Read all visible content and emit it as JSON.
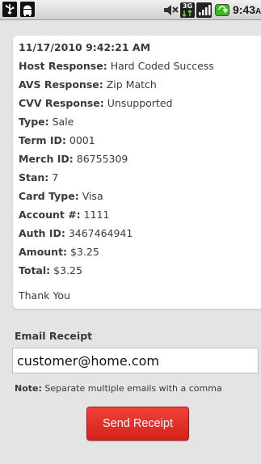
{
  "status_bar": {
    "time": "9:43",
    "ampm": "AM",
    "icons": [
      "usb-icon",
      "android-debug-icon",
      "mute-icon",
      "3g-icon",
      "signal-icon",
      "battery-icon"
    ],
    "network_label": "3G"
  },
  "receipt": {
    "datetime": "11/17/2010 9:42:21 AM",
    "fields": [
      {
        "label": "Host Response:",
        "value": "Hard Coded Success"
      },
      {
        "label": "AVS Response:",
        "value": "Zip Match"
      },
      {
        "label": "CVV Response:",
        "value": "Unsupported"
      },
      {
        "label": "Type:",
        "value": "Sale"
      },
      {
        "label": "Term ID:",
        "value": "0001"
      },
      {
        "label": "Merch ID:",
        "value": "86755309"
      },
      {
        "label": "Stan:",
        "value": "7"
      },
      {
        "label": "Card Type:",
        "value": "Visa"
      },
      {
        "label": "Account #:",
        "value": "1111"
      },
      {
        "label": "Auth ID:",
        "value": "3467464941"
      },
      {
        "label": "Amount:",
        "value": "$3.25"
      },
      {
        "label": "Total:",
        "value": "$3.25"
      }
    ],
    "footer": "Thank You"
  },
  "email": {
    "label": "Email Receipt",
    "value": "customer@home.com",
    "note_label": "Note:",
    "note_text": "Separate multiple emails with a comma"
  },
  "send_button_label": "Send Receipt",
  "colors": {
    "background": "#e4e4e4",
    "card": "#ffffff",
    "button": "#e0342b",
    "text": "#3a3a3a"
  }
}
